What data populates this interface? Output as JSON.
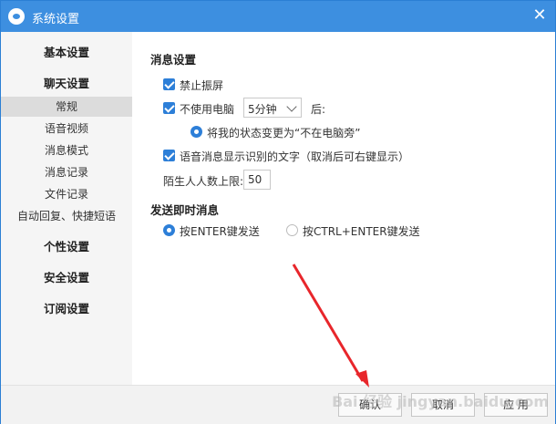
{
  "window": {
    "title": "系统设置",
    "close_glyph": "✕"
  },
  "sidebar": {
    "groups": {
      "basic": "基本设置",
      "chat": "聊天设置",
      "personal": "个性设置",
      "security": "安全设置",
      "subscription": "订阅设置"
    },
    "chat_items": [
      "常规",
      "语音视频",
      "消息模式",
      "消息记录",
      "文件记录",
      "自动回复、快捷短语"
    ],
    "active_item": "常规"
  },
  "content": {
    "message_settings": {
      "title": "消息设置",
      "no_vibrate": "禁止振屏",
      "idle_label": "不使用电脑",
      "idle_value": "5分钟",
      "idle_suffix": "后:",
      "status_change": "将我的状态变更为“不在电脑旁”",
      "voice_text": "语音消息显示识别的文字（取消后可右键显示）",
      "stranger_limit_label": "陌生人人数上限:",
      "stranger_limit_value": "50"
    },
    "send_settings": {
      "title": "发送即时消息",
      "option_enter": "按ENTER键发送",
      "option_ctrl_enter": "按CTRL+ENTER键发送",
      "selected": "按ENTER键发送"
    }
  },
  "footer": {
    "ok": "确认",
    "cancel": "取消",
    "apply": "应 用"
  },
  "watermark": "Bai 经验 jingyan.baidu.com",
  "colors": {
    "titlebar": "#3d8fe0",
    "accent": "#2d7fd8",
    "annotation_arrow": "#e8262b"
  },
  "icons": {
    "app": "app-logo-icon",
    "close": "close-icon",
    "checkbox": "checkbox-checked-icon",
    "radio": "radio-icon",
    "chevron": "chevron-down-icon"
  }
}
